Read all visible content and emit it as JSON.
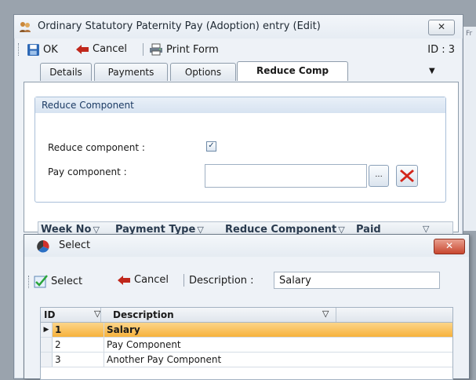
{
  "main_window": {
    "title": "Ordinary Statutory Paternity Pay (Adoption) entry (Edit)",
    "close_glyph": "✕",
    "toolbar": {
      "ok_label": "OK",
      "cancel_label": "Cancel",
      "print_label": "Print Form",
      "id_text": "ID : 3"
    },
    "tabs": [
      {
        "label": "Details"
      },
      {
        "label": "Payments"
      },
      {
        "label": "Options"
      },
      {
        "label": "Reduce Comp"
      }
    ],
    "reduce_group": {
      "header": "Reduce Component",
      "reduce_label": "Reduce component :",
      "reduce_checked": true,
      "pay_label": "Pay component :",
      "pay_value": "",
      "ellipsis": "..."
    },
    "payments_grid": {
      "columns": [
        "Week No",
        "Payment Type",
        "Reduce Component",
        "Paid"
      ]
    }
  },
  "background_window": {
    "text": "Fr"
  },
  "select_dialog": {
    "title": "Select",
    "close_glyph": "✕",
    "toolbar": {
      "select_label": "Select",
      "cancel_label": "Cancel",
      "description_label": "Description :",
      "description_value": "Salary"
    },
    "grid": {
      "columns": [
        "ID",
        "Description"
      ],
      "rows": [
        {
          "id": "1",
          "description": "Salary",
          "selected": true
        },
        {
          "id": "2",
          "description": "Pay Component",
          "selected": false
        },
        {
          "id": "3",
          "description": "Another Pay Component",
          "selected": false
        }
      ]
    }
  },
  "colors": {
    "selected_row": "#f6b23c",
    "accent_blue": "#1c3b64",
    "cancel_red": "#c0281c"
  }
}
